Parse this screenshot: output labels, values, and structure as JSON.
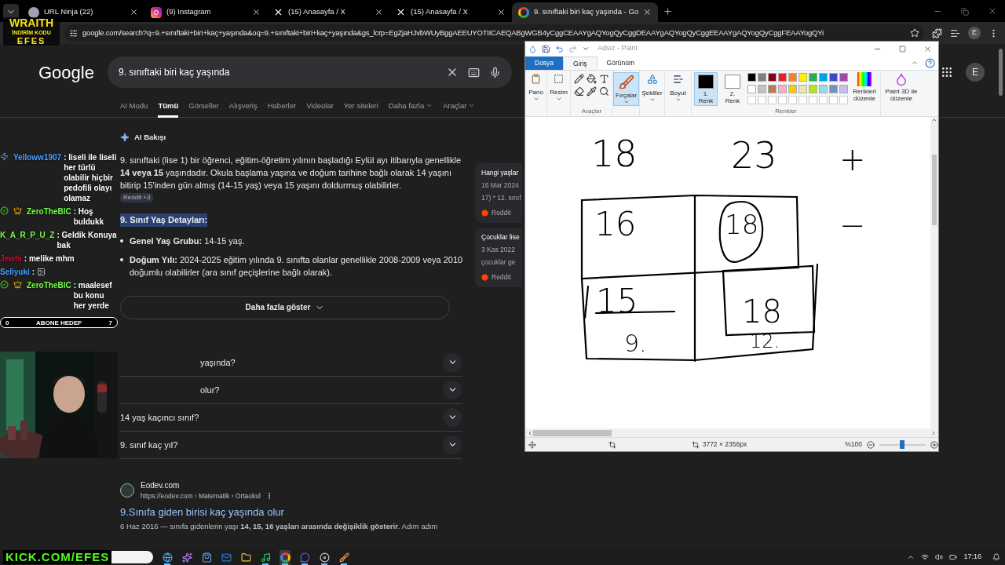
{
  "browser": {
    "tabs": [
      {
        "title": "URL Ninja (22)",
        "selected": false
      },
      {
        "title": "(9) Instagram",
        "selected": false
      },
      {
        "title": "(15) Anasayfa / X",
        "selected": false
      },
      {
        "title": "(15) Anasayfa / X",
        "selected": false
      },
      {
        "title": "9. sınıftaki biri kaç yaşında - Go",
        "selected": true
      }
    ],
    "address": "google.com/search?q=9.+sınıftaki+biri+kaç+yaşında&oq=9.+sınıftaki+biri+kaç+yaşında&gs_lcrp=EgZjaHJvbWUyBggAEEUYOTIICAEQABgWGB4yCggCEAAYgAQYogQyCggDEAAYgAQYogQyCggEEAAYgAQYogQyCggFEAAYogQYi",
    "avatar": "E"
  },
  "overlay": {
    "brand": [
      "WRAITH",
      "İNDİRİM KODU",
      "EFES"
    ],
    "footer": "KICK.COM/EFES"
  },
  "search": {
    "logo": "Google",
    "query": "9. sınıftaki biri kaç yaşında",
    "avatar": "E",
    "tabs": [
      {
        "label": "AI Modu",
        "selected": false,
        "menu": false
      },
      {
        "label": "Tümü",
        "selected": true,
        "menu": false
      },
      {
        "label": "Görseller",
        "selected": false,
        "menu": false
      },
      {
        "label": "Alışveriş",
        "selected": false,
        "menu": false
      },
      {
        "label": "Haberler",
        "selected": false,
        "menu": false
      },
      {
        "label": "Videolar",
        "selected": false,
        "menu": false
      },
      {
        "label": "Yer siteleri",
        "selected": false,
        "menu": false
      },
      {
        "label": "Daha fazla",
        "selected": false,
        "menu": true
      },
      {
        "label": "Araçlar",
        "selected": false,
        "menu": true
      }
    ]
  },
  "ai_overview": {
    "title": "AI Bakışı",
    "paragraph": "9. sınıftaki (lise 1) bir öğrenci, eğitim-öğretim yılının başladığı Eylül ayı itibarıyla genellikle **14 veya 15** yaşındadır. Okula başlama yaşına ve doğum tarihine bağlı olarak 14 yaşını bitirip 15'inden gün almış (14-15 yaş) veya 15 yaşını doldurmuş olabilirler.",
    "source_chip": "Reddit +3",
    "heading": "9. Sınıf Yaş Detayları:",
    "bullets": [
      "**Genel Yaş Grubu:** 14-15 yaş.",
      "**Doğum Yılı:** 2024-2025 eğitim yılında 9. sınıfta olanlar genellikle 2008-2009 veya 2010 doğumlu olabilirler (ara sınıf geçişlerine bağlı olarak)."
    ],
    "show_more": "Daha fazla göster",
    "sources": [
      {
        "title": "Hangi yaşlar",
        "date": "16 Mar 2024",
        "snippet": "17) * 12. sınıf",
        "site": "Reddit"
      },
      {
        "title": "Çocuklar lise",
        "date": "3 Kas 2022",
        "snippet": "çocuklar ge",
        "site": "Reddit"
      }
    ]
  },
  "questions": [
    {
      "text": "yaşında?",
      "expanded": false
    },
    {
      "text": "olur?",
      "expanded": false
    },
    {
      "text": "14 yaş kaçıncı sınıf?",
      "expanded": false
    },
    {
      "text": "9. sınıf kaç yıl?",
      "expanded": false
    }
  ],
  "result": {
    "site": "Eodev.com",
    "url": "https://eodev.com › Matematik › Ortaokul",
    "title": "9.Sınıfa giden birisi kaç yaşında olur",
    "snippet": "6 Haz 2016 — sınıfa gidenlerin yaşı **14, 15, 16 yaşları arasında değişiklik gösterir**. Adım adım"
  },
  "chat": {
    "messages": [
      {
        "user": "Yelloww1907",
        "color": "#4a9eff",
        "text": ": liseli ile liseli her türlü olabilir hiçbir pedofili olayı olamaz",
        "kind": "text"
      },
      {
        "user": "ZeroTheBIC",
        "color": "#75fd46",
        "text": ": Hoş buldukk",
        "kind": "text"
      },
      {
        "user": "K_A_R_P_U_Z",
        "color": "#75fd46",
        "text": ": Geldik Konuya bak",
        "kind": "text"
      },
      {
        "user": "Jewhi",
        "color": "#c8102e",
        "text": ": melike mhm",
        "kind": "text"
      },
      {
        "user": "Seliyuki",
        "color": "#4a9eff",
        "text": ":",
        "kind": "emote"
      },
      {
        "user": "ZeroTheBIC",
        "color": "#75fd46",
        "text": ": maalesef bu konu her yerde",
        "kind": "text"
      }
    ],
    "goal": {
      "start": "0",
      "label": "ABONE HEDEF",
      "end": "7"
    }
  },
  "paint": {
    "title": "Adsız - Paint",
    "tabs": [
      {
        "label": "Dosya",
        "kind": "file",
        "selected": false
      },
      {
        "label": "Giriş",
        "kind": "tab",
        "selected": true
      },
      {
        "label": "Görünüm",
        "kind": "tab",
        "selected": false
      }
    ],
    "clipboard": "Pano",
    "image": "Resim",
    "tools_label": "Araçlar",
    "brushes": {
      "label": "Fırçalar",
      "selected": true
    },
    "shapes": "Şekiller",
    "size": "Boyut",
    "colors": [
      {
        "label": "1. Renk",
        "color": "#000000",
        "selected": true
      },
      {
        "label": "2. Renk",
        "color": "#ffffff",
        "selected": false
      }
    ],
    "palette": [
      {
        "color": "#000000"
      },
      {
        "color": "#7f7f7f"
      },
      {
        "color": "#880015"
      },
      {
        "color": "#ed1c24"
      },
      {
        "color": "#ff7f27"
      },
      {
        "color": "#fff200"
      },
      {
        "color": "#22b14c"
      },
      {
        "color": "#00a2e8"
      },
      {
        "color": "#3f48cc"
      },
      {
        "color": "#a349a4"
      },
      {
        "color": "#ffffff"
      },
      {
        "color": "#c3c3c3"
      },
      {
        "color": "#b97a57"
      },
      {
        "color": "#ffaec9"
      },
      {
        "color": "#ffc90e"
      },
      {
        "color": "#efe4b0"
      },
      {
        "color": "#b5e61d"
      },
      {
        "color": "#99d9ea"
      },
      {
        "color": "#7092be"
      },
      {
        "color": "#c8bfe7"
      }
    ],
    "colors_label": "Renkler",
    "edit_colors": "Renkleri düzenle",
    "paint3d": "Paint 3D ile düzenle",
    "canvas_marks": [
      "18",
      "23",
      "+",
      "16",
      "18",
      "−",
      "15",
      "18",
      "9.",
      "12."
    ],
    "status": {
      "dimensions": "3772 × 2356px",
      "zoom": "%100",
      "zoom_slider": {
        "level": 0.5
      }
    }
  },
  "taskbar": {
    "apps": [
      {
        "kind": "browser",
        "running": true,
        "selected": false
      },
      {
        "kind": "copilot",
        "running": false,
        "selected": false
      },
      {
        "kind": "store",
        "running": false,
        "selected": false
      },
      {
        "kind": "mail",
        "running": false,
        "selected": false
      },
      {
        "kind": "folder",
        "running": false,
        "selected": false
      },
      {
        "kind": "music",
        "running": true,
        "selected": false
      },
      {
        "kind": "chrome",
        "running": true,
        "selected": true
      },
      {
        "kind": "chat",
        "running": true,
        "selected": false
      },
      {
        "kind": "record",
        "running": true,
        "selected": false
      },
      {
        "kind": "paint",
        "running": true,
        "selected": false
      }
    ],
    "time": "17:16"
  }
}
